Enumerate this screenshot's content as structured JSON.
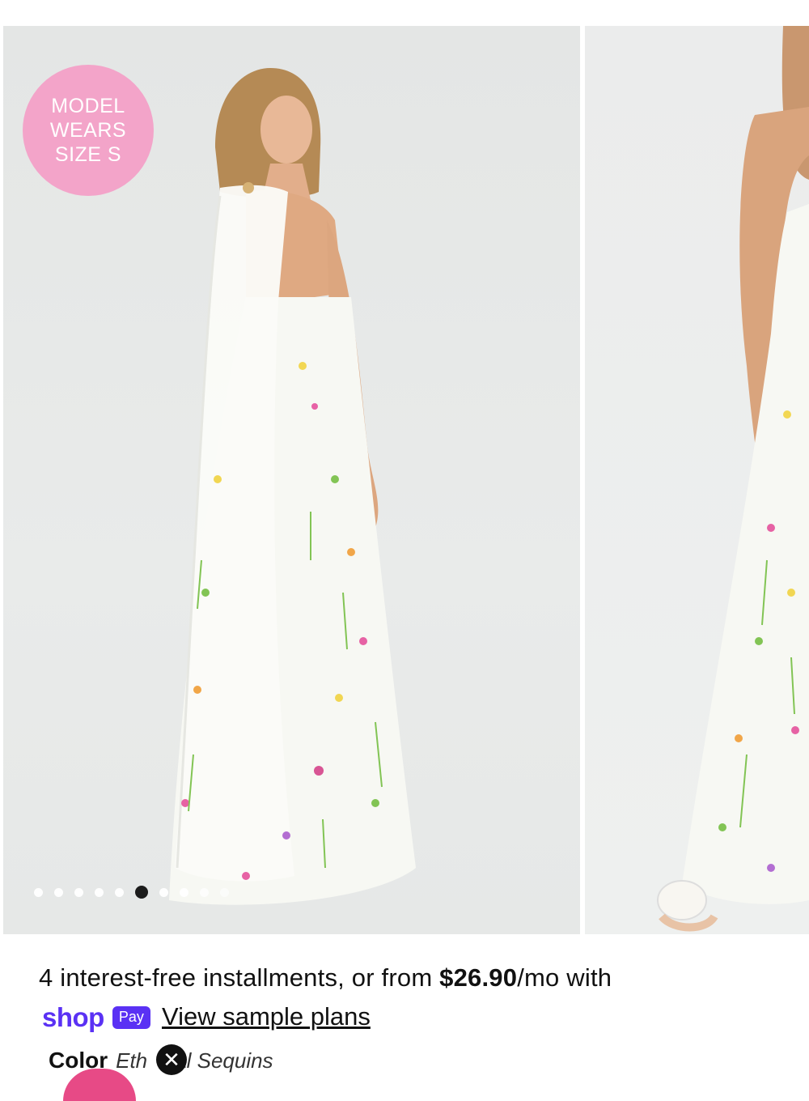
{
  "gallery": {
    "badge_lines": [
      "MODEL",
      "WEARS",
      "SIZE S"
    ],
    "dots_total": 10,
    "active_dot": 5
  },
  "installments": {
    "prefix": "4 interest-free installments, or from ",
    "price": "$26.90",
    "suffix": "/mo with"
  },
  "shop_pay": {
    "shop_word": "shop",
    "pay_word": "Pay",
    "view_plans": "View sample plans"
  },
  "color": {
    "label": "Color",
    "value": "Ethereal Sequins",
    "value_visible_start": "Eth",
    "value_visible_end": "al Sequins"
  },
  "icons": {
    "close": "close-icon"
  },
  "colors": {
    "badge": "#f3a4c9",
    "shop_pay_purple": "#5a31f4",
    "active_dot": "#111111",
    "swatch_pink": "#e74a86"
  }
}
